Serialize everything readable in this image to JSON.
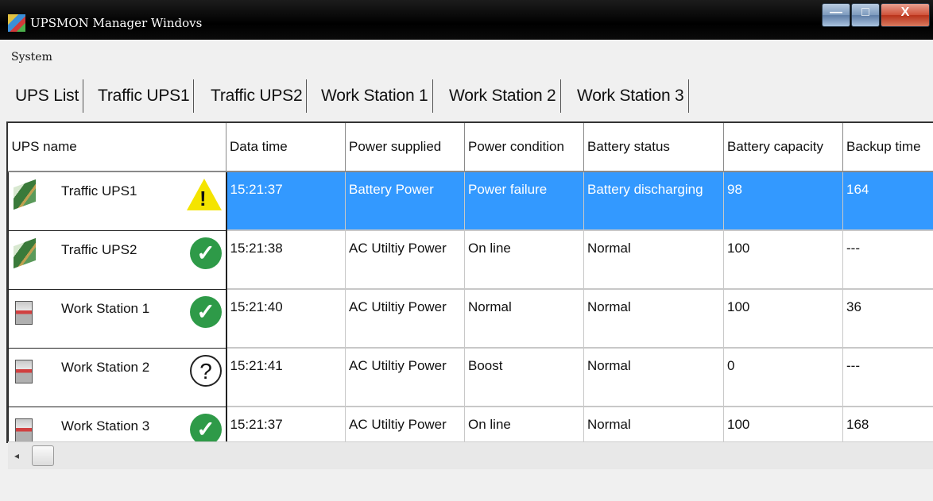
{
  "window": {
    "title": "UPSMON Manager Windovs",
    "min_glyph": "—",
    "max_glyph": "□",
    "close_glyph": "X"
  },
  "menu": {
    "items": [
      "System"
    ]
  },
  "tabs": [
    "UPS List",
    "Traffic UPS1",
    "Traffic UPS2",
    "Work Station 1",
    "Work Station 2",
    "Work Station 3"
  ],
  "table": {
    "columns": [
      "UPS name",
      "Data time",
      "Power supplied",
      "Power condition",
      "Battery status",
      "Battery capacity",
      "Backup time"
    ],
    "rows": [
      {
        "name": "Traffic UPS1",
        "device_icon": "network-card-icon",
        "status_icon": "warning-icon",
        "selected": true,
        "cells": [
          "15:21:37",
          "Battery Power",
          "Power failure",
          "Battery discharging",
          "98",
          "164"
        ]
      },
      {
        "name": "Traffic UPS2",
        "device_icon": "network-card-icon",
        "status_icon": "check-icon",
        "selected": false,
        "cells": [
          "15:21:38",
          "AC Utiltiy Power",
          "On line",
          "Normal",
          "100",
          "---"
        ]
      },
      {
        "name": "Work Station 1",
        "device_icon": "ups-tower-icon",
        "status_icon": "check-icon",
        "selected": false,
        "cells": [
          "15:21:40",
          "AC Utiltiy Power",
          "Normal",
          "Normal",
          "100",
          "36"
        ]
      },
      {
        "name": "Work Station 2",
        "device_icon": "ups-tower-icon",
        "status_icon": "question-icon",
        "selected": false,
        "cells": [
          "15:21:41",
          "AC Utiltiy Power",
          "Boost",
          "Normal",
          "0",
          "---"
        ]
      },
      {
        "name": "Work Station 3",
        "device_icon": "ups-tower-icon",
        "status_icon": "check-icon",
        "selected": false,
        "cells": [
          "15:21:37",
          "AC Utiltiy Power",
          "On line",
          "Normal",
          "100",
          "168"
        ]
      }
    ]
  },
  "scrollbar": {
    "left_arrow": "◂"
  },
  "colors": {
    "selection": "#3399ff",
    "ok": "#2e9a48",
    "warning": "#f4e400"
  }
}
